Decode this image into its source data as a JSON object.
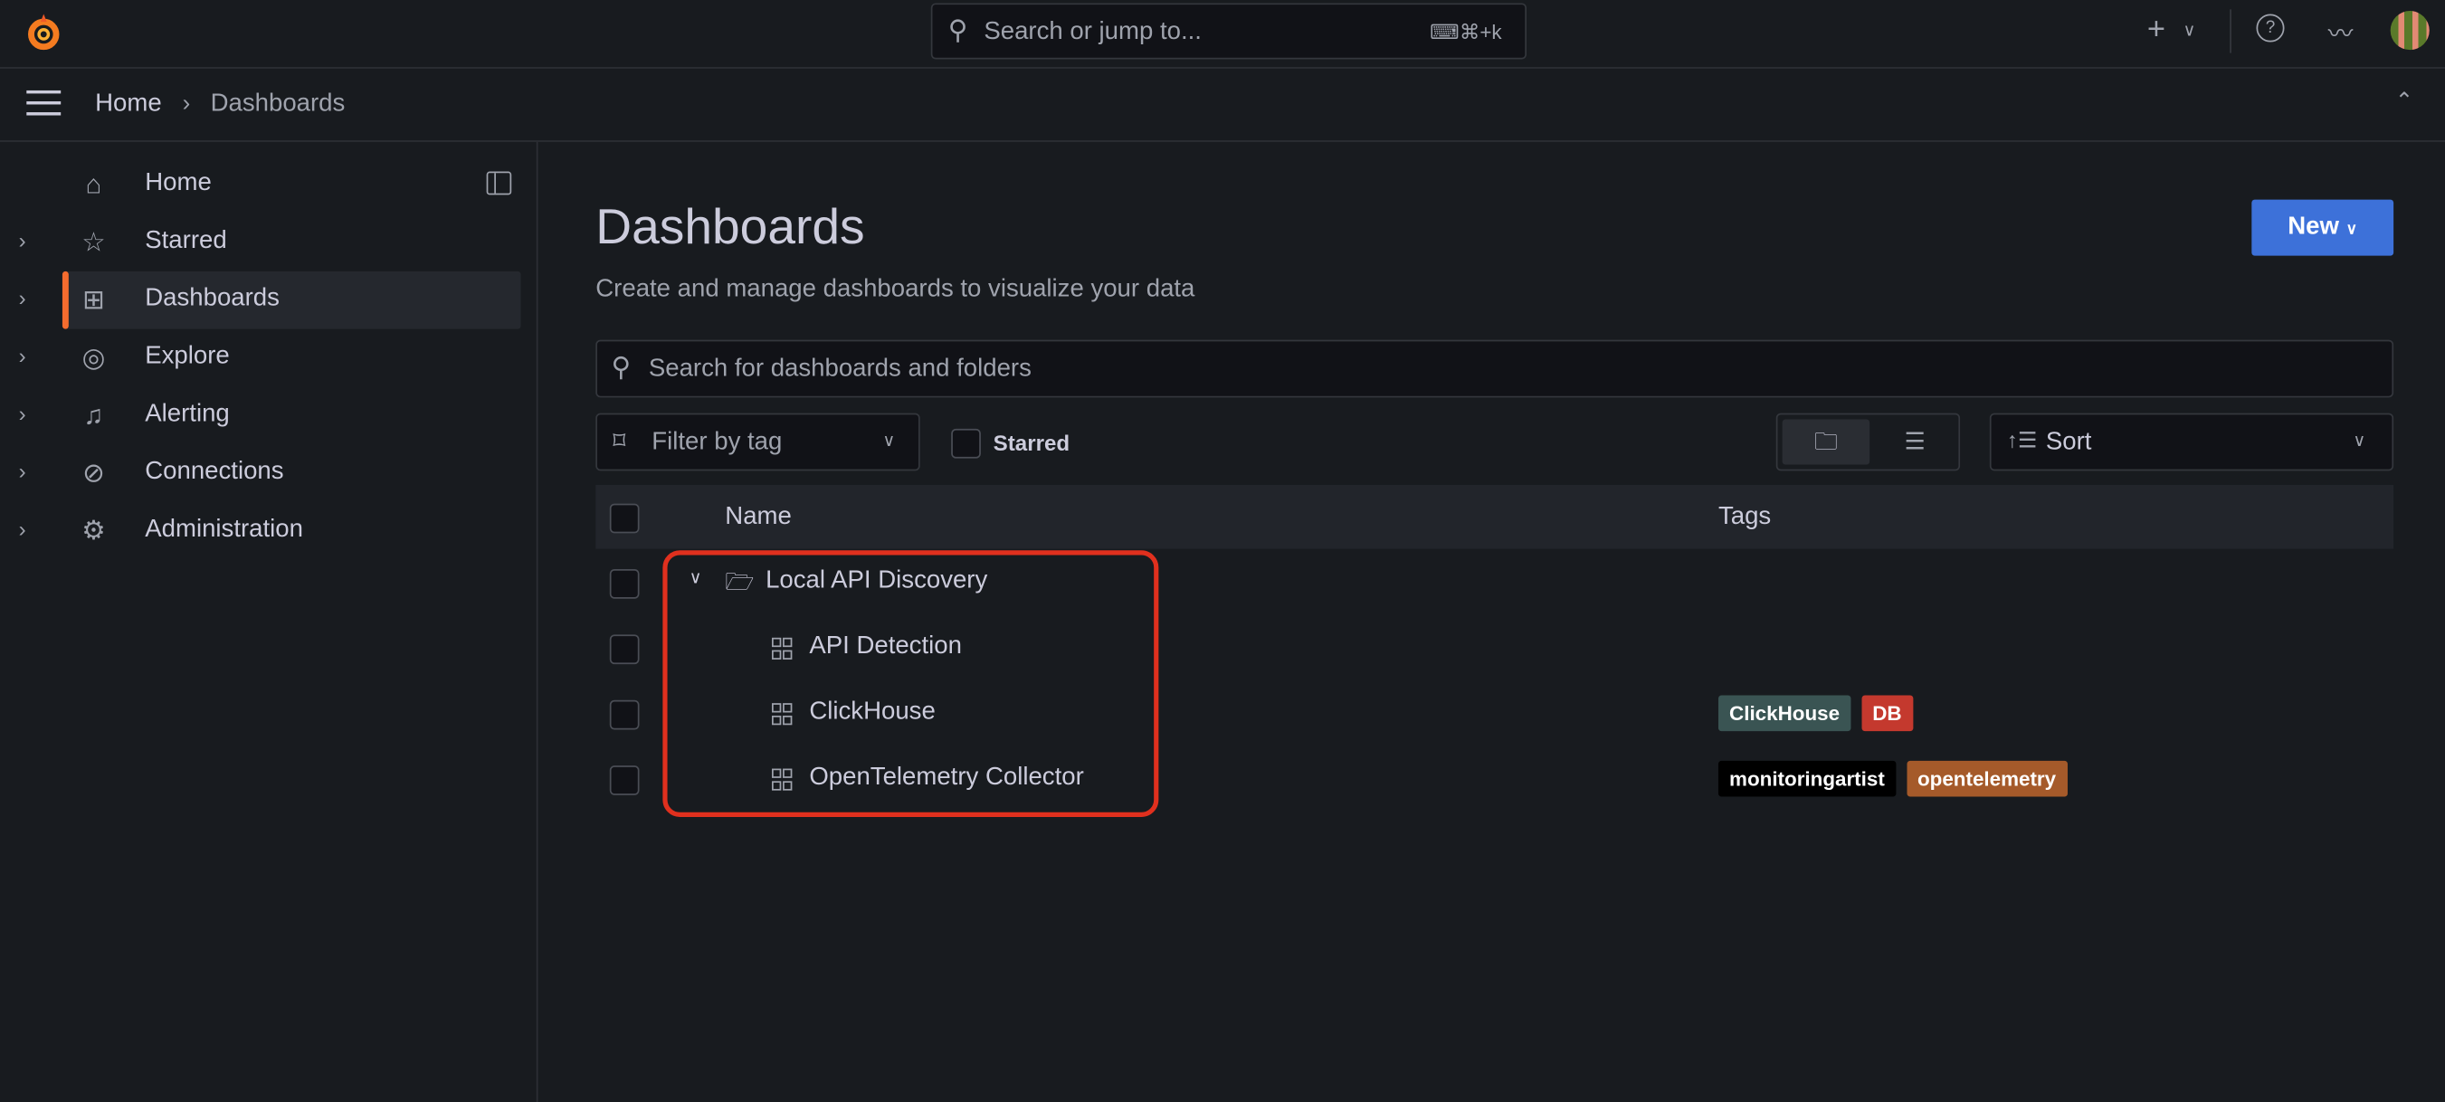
{
  "topbar": {
    "search_placeholder": "Search or jump to...",
    "shortcut": "⌘+k"
  },
  "breadcrumb": {
    "home": "Home",
    "current": "Dashboards"
  },
  "sidebar": {
    "items": [
      {
        "label": "Home",
        "icon": "home-icon",
        "glyph": "⌂"
      },
      {
        "label": "Starred",
        "icon": "star-icon",
        "glyph": "☆"
      },
      {
        "label": "Dashboards",
        "icon": "apps-icon",
        "glyph": "⊞"
      },
      {
        "label": "Explore",
        "icon": "compass-icon",
        "glyph": "◎"
      },
      {
        "label": "Alerting",
        "icon": "bell-icon",
        "glyph": "🔔︎"
      },
      {
        "label": "Connections",
        "icon": "connections-icon",
        "glyph": "⊘"
      },
      {
        "label": "Administration",
        "icon": "gear-icon",
        "glyph": "⚙"
      }
    ]
  },
  "main": {
    "title": "Dashboards",
    "subtitle": "Create and manage dashboards to visualize your data",
    "new_button": "New",
    "search_placeholder": "Search for dashboards and folders",
    "filter_tag_placeholder": "Filter by tag",
    "starred_label": "Starred",
    "sort_label": "Sort",
    "columns": {
      "name": "Name",
      "tags": "Tags"
    },
    "rows": [
      {
        "type": "folder",
        "name": "Local API Discovery",
        "tags": []
      },
      {
        "type": "dashboard",
        "name": "API Detection",
        "tags": []
      },
      {
        "type": "dashboard",
        "name": "ClickHouse",
        "tags": [
          {
            "label": "ClickHouse",
            "color": "#3a5453"
          },
          {
            "label": "DB",
            "color": "#c4392e"
          }
        ]
      },
      {
        "type": "dashboard",
        "name": "OpenTelemetry Collector",
        "tags": [
          {
            "label": "monitoringartist",
            "color": "#000000"
          },
          {
            "label": "opentelemetry",
            "color": "#a55a2a"
          }
        ]
      }
    ]
  },
  "colors": {
    "accent": "#3d71d9",
    "active_bar": "#f56c2e",
    "highlight": "#e0301e"
  }
}
